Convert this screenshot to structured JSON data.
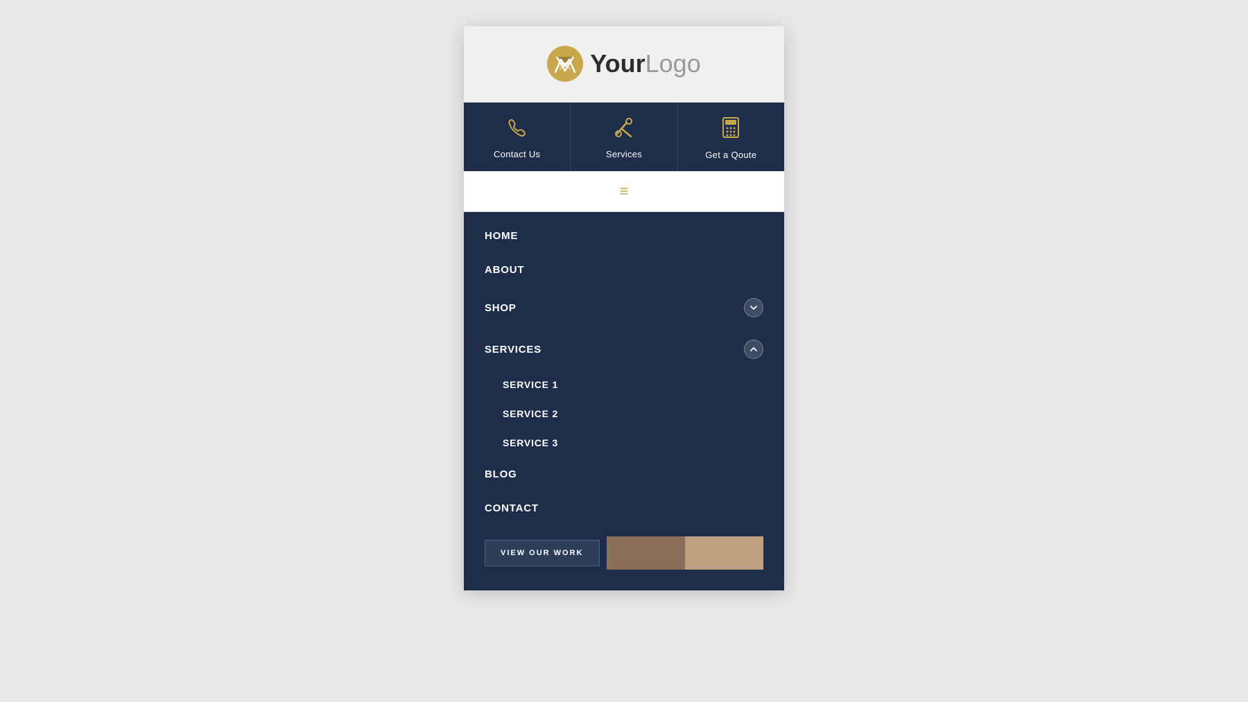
{
  "header": {
    "logo_bold": "Your",
    "logo_light": "Logo"
  },
  "action_bar": {
    "items": [
      {
        "id": "contact-us",
        "label": "Contact Us",
        "icon": "phone"
      },
      {
        "id": "services",
        "label": "Services",
        "icon": "wrench"
      },
      {
        "id": "get-a-quote",
        "label": "Get a Qoute",
        "icon": "calculator"
      }
    ]
  },
  "nav": {
    "menu_icon": "≡",
    "items": [
      {
        "id": "home",
        "label": "HOME",
        "has_dropdown": false,
        "expanded": false
      },
      {
        "id": "about",
        "label": "ABOUT",
        "has_dropdown": false,
        "expanded": false
      },
      {
        "id": "shop",
        "label": "SHOP",
        "has_dropdown": true,
        "expanded": false
      },
      {
        "id": "services",
        "label": "SERVICES",
        "has_dropdown": true,
        "expanded": true
      },
      {
        "id": "blog",
        "label": "BLOG",
        "has_dropdown": false,
        "expanded": false
      },
      {
        "id": "contact",
        "label": "CONTACT",
        "has_dropdown": false,
        "expanded": false
      }
    ],
    "sub_items": [
      {
        "id": "service-1",
        "label": "SERVICE 1"
      },
      {
        "id": "service-2",
        "label": "SERVICE 2"
      },
      {
        "id": "service-3",
        "label": "SERVICE 3"
      }
    ]
  },
  "cta": {
    "button_label": "VIEW OUR WORK"
  },
  "colors": {
    "navy": "#1e2d4a",
    "gold": "#c9a84c",
    "white": "#ffffff",
    "bg": "#f0f0f0"
  }
}
